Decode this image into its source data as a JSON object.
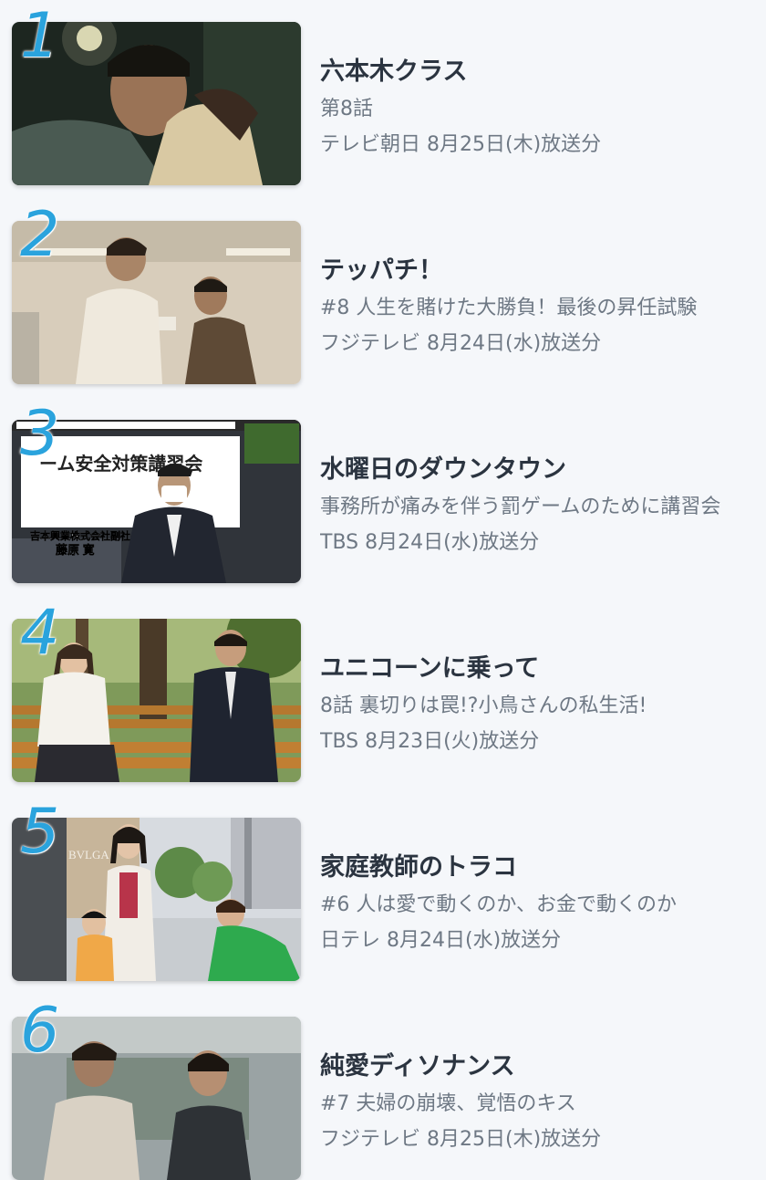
{
  "ranking": [
    {
      "rank": "1",
      "title": "六本木クラス",
      "subtitle": "第8話",
      "broadcast": "テレビ朝日 8月25日(木)放送分",
      "thumbnail": "hug-night-scene"
    },
    {
      "rank": "2",
      "title": "テッパチ！",
      "subtitle": "#8 人生を賭けた大勝負！最後の昇任試験",
      "broadcast": "フジテレビ 8月24日(水)放送分",
      "thumbnail": "office-confrontation-scene"
    },
    {
      "rank": "3",
      "title": "水曜日のダウンタウン",
      "subtitle": "事務所が痛みを伴う罰ゲームのために講習会",
      "broadcast": "TBS 8月24日(水)放送分",
      "thumbnail": "press-conference-scene",
      "thumbnail_text": {
        "banner": "ーム安全対策講習会",
        "caption_1": "吉本興業株式会社副社長",
        "caption_2": "藤原 寛"
      }
    },
    {
      "rank": "4",
      "title": "ユニコーンに乗って",
      "subtitle": "8話 裏切りは罠!?小鳥さんの私生活!",
      "broadcast": "TBS 8月23日(火)放送分",
      "thumbnail": "park-bench-scene"
    },
    {
      "rank": "5",
      "title": "家庭教師のトラコ",
      "subtitle": "#6 人は愛で動くのか、お金で動くのか",
      "broadcast": "日テレ 8月24日(水)放送分",
      "thumbnail": "street-scene",
      "thumbnail_text": {
        "sign": "BVLGA"
      }
    },
    {
      "rank": "6",
      "title": "純愛ディソナンス",
      "subtitle": "#7 夫婦の崩壊、覚悟のキス",
      "broadcast": "フジテレビ 8月25日(木)放送分",
      "thumbnail": "two-men-scene"
    }
  ],
  "colors": {
    "rank": "#2aa3dd",
    "title": "#2b3440",
    "meta": "#6e7884",
    "background": "#f5f7fa"
  }
}
